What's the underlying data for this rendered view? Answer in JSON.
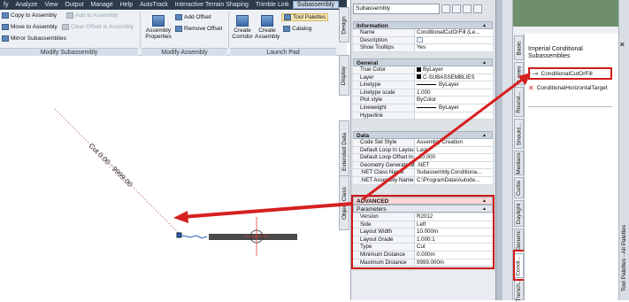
{
  "menubar": [
    "fy",
    "Analyze",
    "View",
    "Output",
    "Manage",
    "Help",
    "AutoTrack",
    "Interactive Terrain Shaping",
    "Trimble Link",
    "Subassembly"
  ],
  "ribbon": {
    "modify_subassembly": {
      "label": "Modify Subassembly",
      "items": [
        "Copy to Assembly",
        "Add to Assembly",
        "Move to Assembly",
        "Clear Offset in Assembly",
        "Mirror Subassemblies"
      ]
    },
    "modify_assembly": {
      "label": "Modify Assembly",
      "properties": "Assembly Properties",
      "add_offset": "Add Offset",
      "remove_offset": "Remove Offset"
    },
    "launch_pad": {
      "label": "Launch Pad",
      "create_corridor": "Create Corridor",
      "create_assembly": "Create Assembly",
      "tool_palettes": "Tool Palettes",
      "catalog": "Catalog"
    },
    "design_tab": "Design"
  },
  "drawing": {
    "label": "Cut 0.00 : 9999.00"
  },
  "left_tabs": [
    "Design",
    "Display",
    "Extended Data",
    "Object Class"
  ],
  "properties": {
    "combo": "Subassembly",
    "sections": {
      "information": "Information",
      "general": "General",
      "data": "Data",
      "advanced": "ADVANCED",
      "parameters": "Parameters"
    },
    "information": [
      {
        "k": "Name",
        "v": "ConditionalCutOrFill (Le..."
      },
      {
        "k": "Description",
        "v": ""
      },
      {
        "k": "Show Tooltips",
        "v": "Yes"
      }
    ],
    "general": [
      {
        "k": "True Color",
        "v": "ByLayer"
      },
      {
        "k": "Layer",
        "v": "C-SUBASSEMBLIES"
      },
      {
        "k": "Linetype",
        "v": "ByLayer"
      },
      {
        "k": "Linetype scale",
        "v": "1.000"
      },
      {
        "k": "Plot style",
        "v": "ByColor"
      },
      {
        "k": "Lineweight",
        "v": "ByLayer"
      },
      {
        "k": "Hyperlink",
        "v": ""
      }
    ],
    "data": [
      {
        "k": "Code Set Style",
        "v": "Assembly Creation"
      },
      {
        "k": "Default Loop In Layou...",
        "v": "Last"
      },
      {
        "k": "Default Loop Offset In...",
        "v": "-10.000"
      },
      {
        "k": "Geometry Generate M...",
        "v": ".NET"
      },
      {
        "k": ".NET Class Name",
        "v": "Subassembly.Conditiona..."
      },
      {
        "k": ".NET Assembly Name",
        "v": "C:\\ProgramData\\Autode..."
      }
    ],
    "parameters": [
      {
        "k": "Version",
        "v": "R2012"
      },
      {
        "k": "Side",
        "v": "Left"
      },
      {
        "k": "Layout Width",
        "v": "10.000m"
      },
      {
        "k": "Layout Grade",
        "v": "1.000:1"
      },
      {
        "k": "Type",
        "v": "Cut"
      },
      {
        "k": "Minimum Distance",
        "v": "0.000m"
      },
      {
        "k": "Maximum Distance",
        "v": "9999.000m"
      }
    ]
  },
  "tool_palette": {
    "tabs": [
      "Basic",
      "Lanes",
      "Round...",
      "Should...",
      "Medians",
      "Curbs",
      "Daylight",
      "Generic",
      "Condi...",
      "Trench..."
    ],
    "heading": "Imperial Conditional Subassemblies",
    "items": [
      "ConditionalCutOrFill",
      "ConditionalHorizontalTarget"
    ],
    "title": "Tool Palettes - All Palettes"
  },
  "colors": {
    "highlight": "#d11a1a",
    "arrow": "#d62020",
    "menubar": "#2d3a4a",
    "palette_green": "#6f8f6c"
  }
}
